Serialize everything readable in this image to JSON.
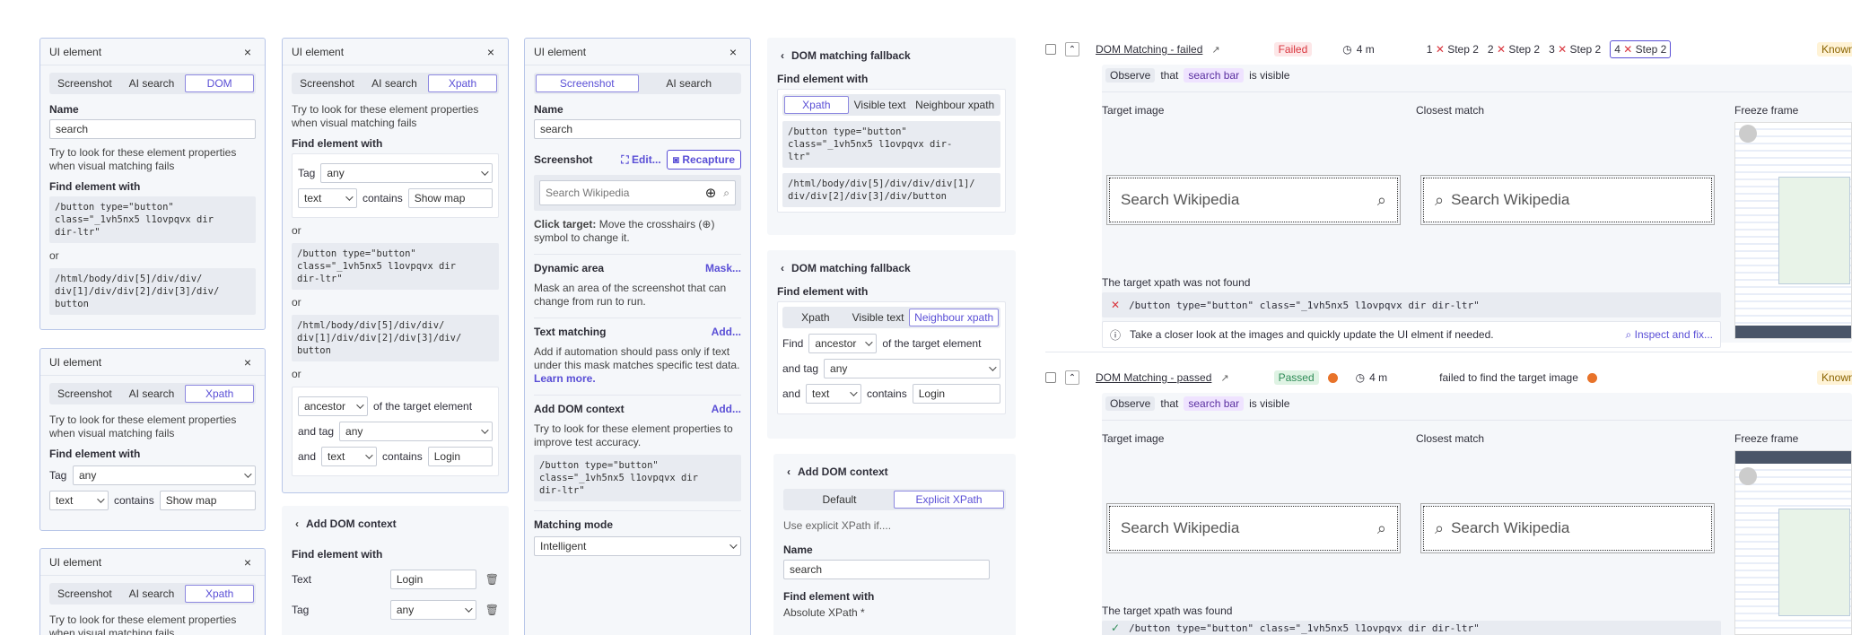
{
  "p1": {
    "title": "UI element",
    "tabs": [
      "Screenshot",
      "AI search",
      "DOM"
    ],
    "name_label": "Name",
    "name_value": "search",
    "hint": "Try to look for these element properties when visual matching fails",
    "find_label": "Find element with",
    "code1": "/button type=\"button\"\nclass=\"_1vh5nx5 l1ovpqvx dir\ndir-ltr\"",
    "or": "or",
    "code2": "/html/body/div[5]/div/div/\ndiv[1]/div/div[2]/div[3]/div/\nbutton"
  },
  "p2": {
    "title": "UI element",
    "tabs": [
      "Screenshot",
      "AI search",
      "Xpath"
    ],
    "hint": "Try to look for these element properties when visual matching fails",
    "find_label": "Find element with",
    "tag_label": "Tag",
    "tag_value": "any",
    "attr_value": "text",
    "contains": "contains",
    "contains_value": "Show map"
  },
  "p3": {
    "title": "UI element",
    "tabs": [
      "Screenshot",
      "AI search",
      "Xpath"
    ],
    "hint": "Try to look for these element properties when visual matching fails"
  },
  "p4": {
    "title": "UI element",
    "tabs": [
      "Screenshot",
      "AI search",
      "Xpath"
    ],
    "hint": "Try to look for these element properties when visual matching fails",
    "find_label": "Find element with",
    "tag_label": "Tag",
    "tag_value": "any",
    "attr_value": "text",
    "contains": "contains",
    "contains_value": "Show map",
    "or": "or",
    "code1": "/button type=\"button\"\nclass=\"_1vh5nx5 l1ovpqvx dir\ndir-ltr\"",
    "code2": "/html/body/div[5]/div/div/\ndiv[1]/div/div[2]/div[3]/div/\nbutton",
    "rel_value": "ancestor",
    "rel_text": "of the target element",
    "and_tag": "and tag",
    "and": "and",
    "login": "Login"
  },
  "p5": {
    "title": "Add DOM context",
    "find_label": "Find element with",
    "text_label": "Text",
    "text_value": "Login",
    "tag_label": "Tag",
    "tag_value": "any"
  },
  "p6": {
    "title": "UI element",
    "tabs": [
      "Screenshot",
      "AI search"
    ],
    "name_label": "Name",
    "name_value": "search",
    "screenshot_label": "Screenshot",
    "edit": "Edit...",
    "recapture": "Recapture",
    "search_placeholder": "Search Wikipedia",
    "click_target_b": "Click target:",
    "click_target": " Move the crosshairs (⊕) symbol to change it.",
    "dyn_label": "Dynamic area",
    "mask": "Mask...",
    "dyn_text": "Mask an area of the screenshot that can change from run to run.",
    "tm_label": "Text matching",
    "add": "Add...",
    "tm_text": "Add if automation should pass only if text under this mask matches specific test data.",
    "learn": "Learn more.",
    "dom_label": "Add DOM context",
    "dom_text": "Try to look for these element properties to improve test accuracy.",
    "code": "/button type=\"button\"\nclass=\"_1vh5nx5 l1ovpqvx dir\ndir-ltr\"",
    "mm_label": "Matching mode",
    "mm_value": "Intelligent"
  },
  "p7": {
    "title": "DOM matching fallback",
    "find_label": "Find element with",
    "tabs": [
      "Xpath",
      "Visible text",
      "Neighbour xpath"
    ],
    "code1": "/button type=\"button\"\nclass=\"_1vh5nx5 l1ovpqvx dir-\nltr\"",
    "code2": "/html/body/div[5]/div/div/div[1]/\ndiv/div[2]/div[3]/div/button"
  },
  "p8": {
    "title": "DOM matching fallback",
    "find_label": "Find element with",
    "tabs": [
      "Xpath",
      "Visible text",
      "Neighbour xpath"
    ],
    "find": "Find",
    "rel_value": "ancestor",
    "rel_text": "of the target element",
    "and_tag": "and tag",
    "tag_value": "any",
    "and": "and",
    "attr_value": "text",
    "contains": "contains",
    "login": "Login"
  },
  "p9": {
    "title": "Add DOM context",
    "tabs": [
      "Default",
      "Explicit XPath"
    ],
    "use": "Use explicit XPath if....",
    "name_label": "Name",
    "name_value": "search",
    "find_label": "Find element with",
    "abs": "Absolute XPath *"
  },
  "r1": {
    "title": "DOM Matching - failed",
    "status": "Failed",
    "time": "4 m",
    "steps": [
      {
        "n": "1",
        "s": "Step 2"
      },
      {
        "n": "2",
        "s": "Step 2"
      },
      {
        "n": "3",
        "s": "Step 2"
      },
      {
        "n": "4",
        "s": "Step 2"
      }
    ],
    "known": "Known",
    "observe": "Observe",
    "that": "that",
    "element": "search bar",
    "visible": "is visible",
    "target": "Target image",
    "closest": "Closest match",
    "freeze": "Freeze frame",
    "search": "Search Wikipedia",
    "xpath_msg": "The target xpath was not found",
    "xpath": "/button type=\"button\" class=\"_1vh5nx5 l1ovpqvx dir dir-ltr\"",
    "info": "Take a closer look at the images and quickly update the UI elment if needed.",
    "inspect": "Inspect and fix..."
  },
  "r2": {
    "title": "DOM Matching - passed",
    "status": "Passed",
    "time": "4 m",
    "failed_text": "failed to find the target image",
    "known": "Known",
    "observe": "Observe",
    "that": "that",
    "element": "search bar",
    "visible": "is visible",
    "target": "Target image",
    "closest": "Closest match",
    "freeze": "Freeze frame",
    "search": "Search Wikipedia",
    "xpath_msg": "The target xpath was found",
    "xpath": "/button type=\"button\" class=\"_1vh5nx5 l1ovpqvx dir dir-ltr\""
  },
  "colors": {
    "accent": "#5a4fd6",
    "failed": "#d9363e",
    "passed": "#2e8b57",
    "highlight": "#efe3ff"
  }
}
